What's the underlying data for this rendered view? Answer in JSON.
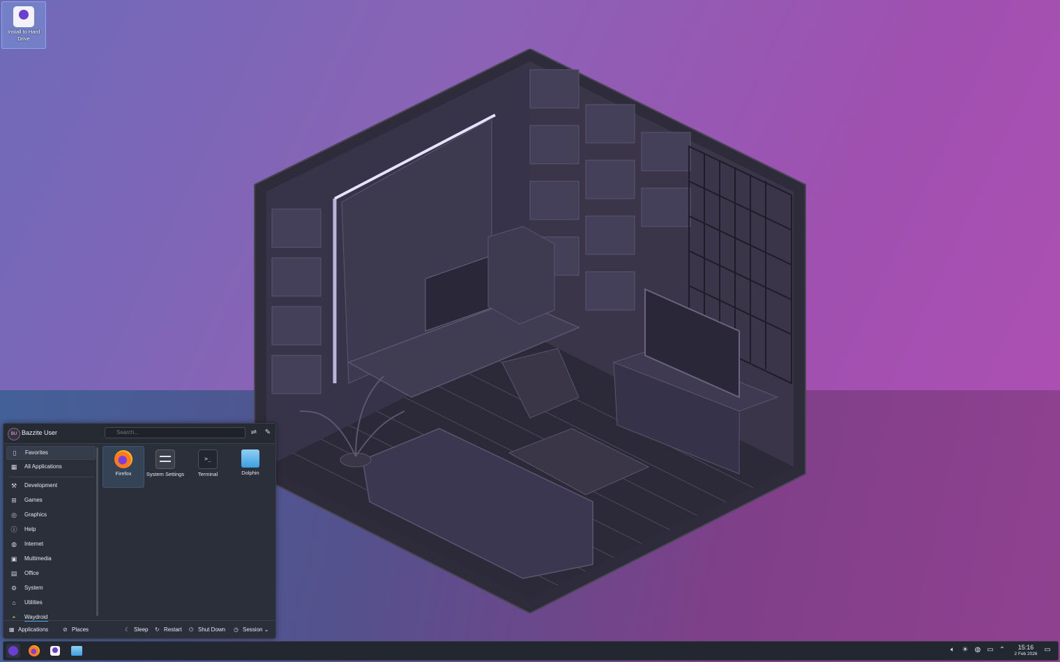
{
  "desktop": {
    "icon_label": "Install to Hard Drive"
  },
  "launcher": {
    "user_initials": "BU",
    "username": "Bazzite User",
    "search_placeholder": "Search...",
    "categories": [
      {
        "label": "Favorites",
        "icon": "bookmark-icon"
      },
      {
        "label": "All Applications",
        "icon": "grid-icon"
      },
      {
        "label": "Development",
        "icon": "wrench-icon"
      },
      {
        "label": "Games",
        "icon": "gamepad-icon"
      },
      {
        "label": "Graphics",
        "icon": "palette-icon"
      },
      {
        "label": "Help",
        "icon": "info-icon"
      },
      {
        "label": "Internet",
        "icon": "globe-icon"
      },
      {
        "label": "Multimedia",
        "icon": "monitor-play-icon"
      },
      {
        "label": "Office",
        "icon": "document-icon"
      },
      {
        "label": "System",
        "icon": "gear-icon"
      },
      {
        "label": "Utilities",
        "icon": "toolbox-icon"
      },
      {
        "label": "Waydroid",
        "icon": "android-icon"
      }
    ],
    "favorites": [
      {
        "label": "Firefox",
        "icon": "firefox-icon"
      },
      {
        "label": "System Settings",
        "icon": "settings-icon"
      },
      {
        "label": "Terminal",
        "icon": "terminal-icon"
      },
      {
        "label": "Dolphin",
        "icon": "folder-icon"
      }
    ],
    "footer": {
      "applications": "Applications",
      "places": "Places",
      "sleep": "Sleep",
      "restart": "Restart",
      "shutdown": "Shut Down",
      "session": "Session"
    }
  },
  "taskbar": {
    "time": "15:16",
    "date": "2 Feb 2026"
  }
}
